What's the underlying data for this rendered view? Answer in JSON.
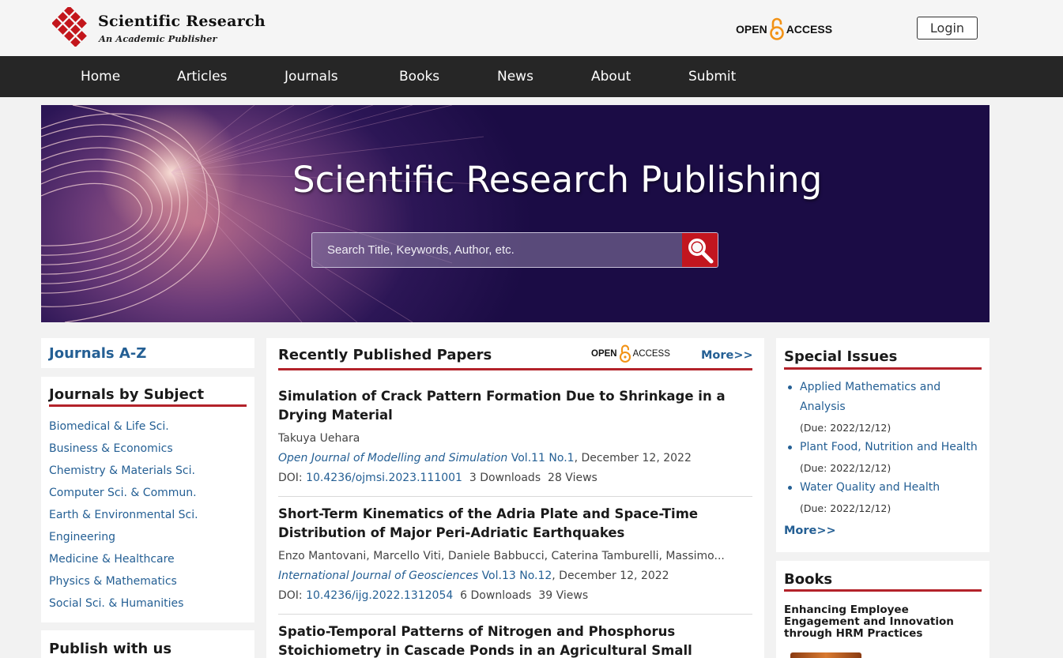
{
  "header": {
    "logo_title": "Scientific Research",
    "logo_subtitle": "An Academic Publisher",
    "open_access_left": "OPEN",
    "open_access_right": "ACCESS",
    "login_label": "Login"
  },
  "nav": [
    "Home",
    "Articles",
    "Journals",
    "Books",
    "News",
    "About",
    "Submit"
  ],
  "hero": {
    "title": "Scientific Research Publishing",
    "search_placeholder": "Search Title, Keywords, Author, etc."
  },
  "left": {
    "journals_az": "Journals A-Z",
    "by_subject_title": "Journals by Subject",
    "subjects": [
      "Biomedical & Life Sci.",
      "Business & Economics",
      "Chemistry & Materials Sci.",
      "Computer Sci. & Commun.",
      "Earth & Environmental Sci.",
      "Engineering",
      "Medicine & Healthcare",
      "Physics & Mathematics",
      "Social Sci. & Humanities"
    ],
    "publish_title": "Publish with us"
  },
  "center": {
    "title": "Recently Published Papers",
    "open_access_left": "OPEN",
    "open_access_right": "ACCESS",
    "more": "More>>",
    "papers": [
      {
        "title": "Simulation of Crack Pattern Formation Due to Shrinkage in a Drying Material",
        "authors": "Takuya Uehara",
        "journal": "Open Journal of Modelling and Simulation",
        "volume": "Vol.11 No.1",
        "date": ", December 12, 2022",
        "doi_label": "DOI:",
        "doi": "10.4236/ojmsi.2023.111001",
        "downloads": "3 Downloads",
        "views": "28 Views"
      },
      {
        "title": "Short-Term Kinematics of the Adria Plate and Space-Time Distribution of Major Peri-Adriatic Earthquakes",
        "authors": "Enzo Mantovani, Marcello Viti, Daniele Babbucci, Caterina Tamburelli, Massimo...",
        "journal": "International Journal of Geosciences",
        "volume": "Vol.13 No.12",
        "date": ", December 12, 2022",
        "doi_label": "DOI:",
        "doi": "10.4236/ijg.2022.1312054",
        "downloads": "6 Downloads",
        "views": "39 Views"
      },
      {
        "title": "Spatio-Temporal Patterns of Nitrogen and Phosphorus Stoichiometry in Cascade Ponds in an Agricultural Small"
      }
    ]
  },
  "right": {
    "special_title": "Special Issues",
    "special_items": [
      {
        "name": "Applied Mathematics and Analysis",
        "due": "(Due: 2022/12/12)"
      },
      {
        "name": "Plant Food, Nutrition and Health",
        "due": "(Due: 2022/12/12)"
      },
      {
        "name": "Water Quality and Health",
        "due": "(Due: 2022/12/12)"
      }
    ],
    "more": "More>>",
    "books_title": "Books",
    "book_name": "Enhancing Employee Engagement and Innovation through HRM Practices"
  }
}
